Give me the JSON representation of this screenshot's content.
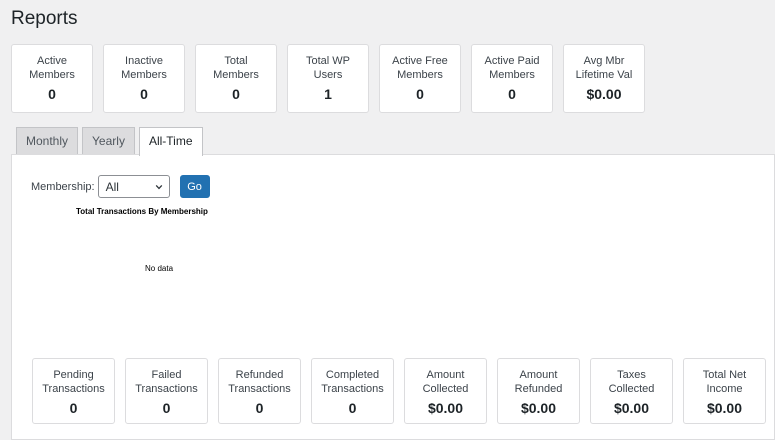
{
  "page": {
    "title": "Reports"
  },
  "summary_cards": [
    {
      "label": "Active\nMembers",
      "value": "0"
    },
    {
      "label": "Inactive\nMembers",
      "value": "0"
    },
    {
      "label": "Total\nMembers",
      "value": "0"
    },
    {
      "label": "Total WP\nUsers",
      "value": "1"
    },
    {
      "label": "Active Free\nMembers",
      "value": "0"
    },
    {
      "label": "Active Paid\nMembers",
      "value": "0"
    },
    {
      "label": "Avg Mbr\nLifetime Val",
      "value": "$0.00"
    }
  ],
  "tabs": [
    {
      "label": "Monthly",
      "active": false
    },
    {
      "label": "Yearly",
      "active": false
    },
    {
      "label": "All-Time",
      "active": true
    }
  ],
  "filter": {
    "label": "Membership:",
    "selected": "All",
    "go_label": "Go"
  },
  "chart": {
    "title": "Total Transactions By Membership",
    "empty_text": "No data"
  },
  "transaction_cards": [
    {
      "label": "Pending\nTransactions",
      "value": "0"
    },
    {
      "label": "Failed\nTransactions",
      "value": "0"
    },
    {
      "label": "Refunded\nTransactions",
      "value": "0"
    },
    {
      "label": "Completed\nTransactions",
      "value": "0"
    },
    {
      "label": "Amount\nCollected",
      "value": "$0.00"
    },
    {
      "label": "Amount\nRefunded",
      "value": "$0.00"
    },
    {
      "label": "Taxes\nCollected",
      "value": "$0.00"
    },
    {
      "label": "Total Net\nIncome",
      "value": "$0.00"
    }
  ],
  "colors": {
    "accent": "#2271b1",
    "background": "#f0f0f1"
  }
}
